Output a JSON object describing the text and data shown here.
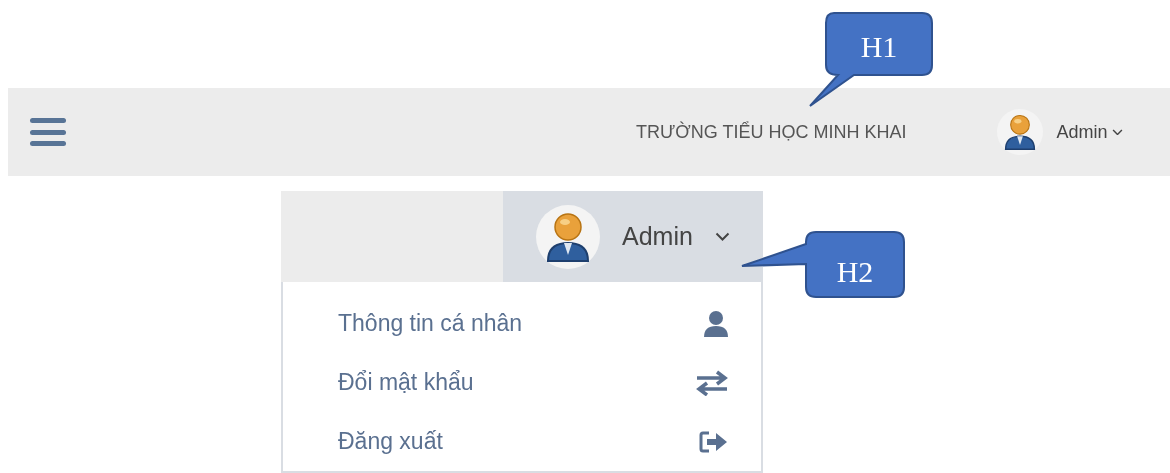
{
  "header": {
    "title": "TRƯỜNG TIỂU HỌC MINH KHAI",
    "user": "Admin"
  },
  "user_menu": {
    "user": "Admin",
    "items": [
      {
        "label": "Thông tin cá nhân",
        "kind": "profile"
      },
      {
        "label": "Đổi mật khẩu",
        "kind": "swap"
      },
      {
        "label": "Đăng xuất",
        "kind": "logout"
      }
    ]
  },
  "callouts": [
    {
      "label": "H1"
    },
    {
      "label": "H2"
    }
  ]
}
